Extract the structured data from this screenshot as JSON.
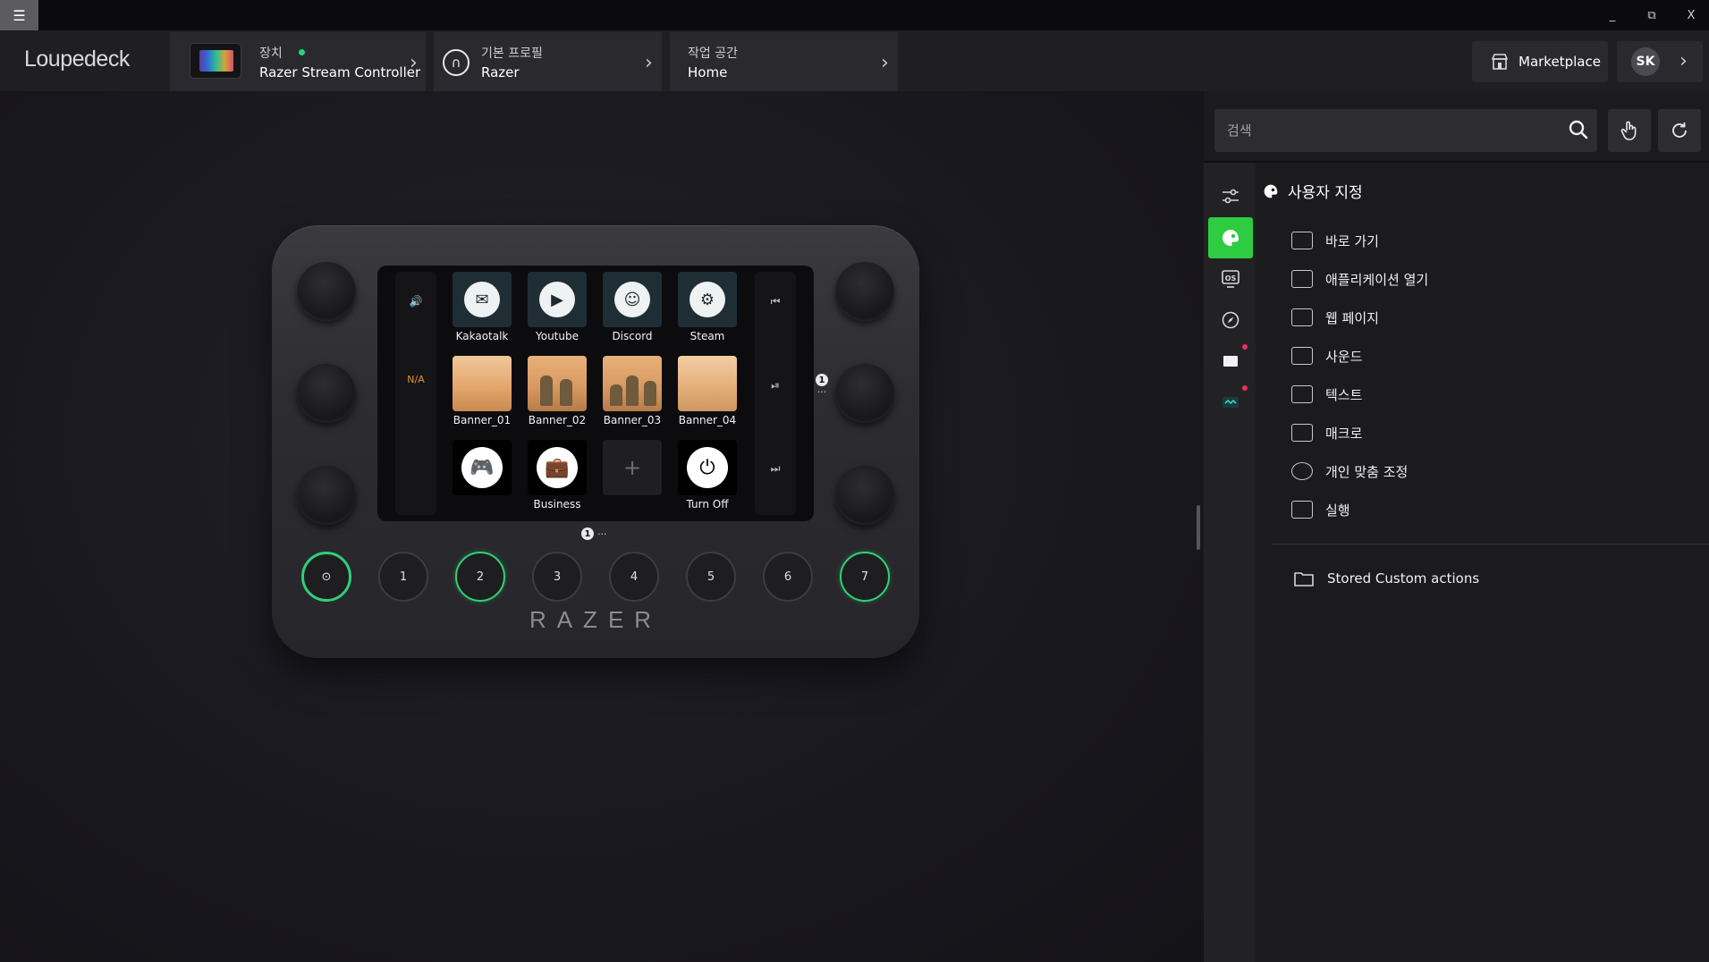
{
  "titlebar": {
    "menu_glyph": "☰",
    "minimize": "_",
    "restore": "⧉",
    "close": "X"
  },
  "header": {
    "brand": "Loupedeck",
    "device": {
      "label": "장치",
      "name": "Razer Stream Controller",
      "status_color": "#1ed97a"
    },
    "profile": {
      "label": "기본 프로필",
      "name": "Razer"
    },
    "workspace": {
      "label": "작업 공간",
      "name": "Home"
    },
    "marketplace": "Marketplace",
    "avatar_initials": "SK",
    "chevron": "›"
  },
  "device": {
    "brand_logo": "RAZER",
    "left_strip": {
      "top_icon": "🔊",
      "mid_label": "N/A"
    },
    "right_strip": {
      "prev": "⏮",
      "play": "⏯",
      "next": "⏭"
    },
    "tiles": [
      {
        "label": "Kakaotalk",
        "kind": "app",
        "icon": "messenger-icon",
        "glyph": "✉"
      },
      {
        "label": "Youtube",
        "kind": "app",
        "icon": "youtube-icon",
        "glyph": "▶"
      },
      {
        "label": "Discord",
        "kind": "app",
        "icon": "discord-icon",
        "glyph": "☺"
      },
      {
        "label": "Steam",
        "kind": "app",
        "icon": "steam-icon",
        "glyph": "⚙"
      },
      {
        "label": "Banner_01",
        "kind": "banner"
      },
      {
        "label": "Banner_02",
        "kind": "banner"
      },
      {
        "label": "Banner_03",
        "kind": "banner"
      },
      {
        "label": "Banner_04",
        "kind": "banner"
      },
      {
        "label": "",
        "kind": "plain",
        "icon": "gamepad-icon",
        "glyph": "🎮"
      },
      {
        "label": "Business",
        "kind": "plain",
        "icon": "briefcase-icon",
        "glyph": "💼"
      },
      {
        "label": "",
        "kind": "empty",
        "glyph": "+"
      },
      {
        "label": "Turn Off",
        "kind": "plain",
        "icon": "power-icon",
        "glyph": "⏻"
      }
    ],
    "page_indicator_right": {
      "num": "1",
      "dots": "···"
    },
    "page_indicator_bottom": {
      "num": "1",
      "dots": "···"
    },
    "buttons": [
      "⊙",
      "1",
      "2",
      "3",
      "4",
      "5",
      "6",
      "7"
    ]
  },
  "panel": {
    "search_placeholder": "검색",
    "category_title": "사용자 지정",
    "actions": [
      {
        "label": "바로 가기",
        "icon": "keyboard-icon"
      },
      {
        "label": "애플리케이션 열기",
        "icon": "app-window-icon"
      },
      {
        "label": "웹 페이지",
        "icon": "web-link-icon"
      },
      {
        "label": "사운드",
        "icon": "sound-play-icon"
      },
      {
        "label": "텍스트",
        "icon": "text-icon"
      },
      {
        "label": "매크로",
        "icon": "macro-icon"
      },
      {
        "label": "개인 맞춤 조정",
        "icon": "rotate-icon"
      },
      {
        "label": "실행",
        "icon": "run-icon"
      }
    ],
    "stored_actions": "Stored Custom actions"
  },
  "colors": {
    "accent_green": "#2ecc40",
    "notification_red": "#e8315c",
    "na_orange": "#e8902a"
  }
}
